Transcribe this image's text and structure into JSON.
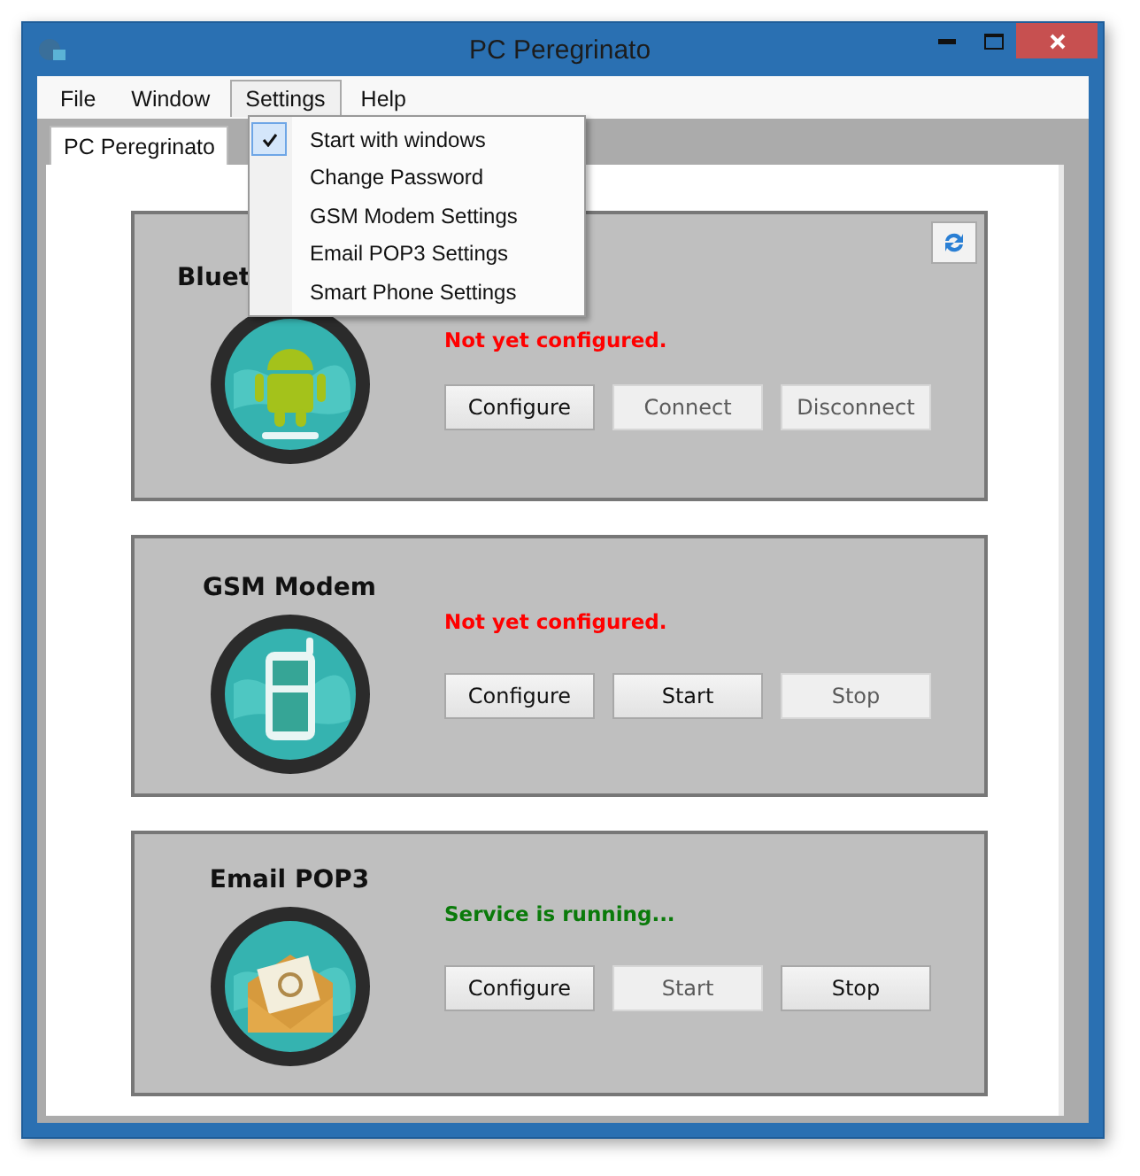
{
  "window": {
    "title": "PC Peregrinato"
  },
  "menu_bar": [
    {
      "label": "File",
      "selected": false
    },
    {
      "label": "Window",
      "selected": false
    },
    {
      "label": "Settings",
      "selected": true
    },
    {
      "label": "Help",
      "selected": false
    }
  ],
  "settings_menu": [
    {
      "label": "Start with windows",
      "checked": true
    },
    {
      "label": "Change Password",
      "checked": false
    },
    {
      "label": "GSM Modem Settings",
      "checked": false
    },
    {
      "label": "Email POP3 Settings",
      "checked": false
    },
    {
      "label": "Smart Phone Settings",
      "checked": false
    }
  ],
  "tabs": [
    {
      "label": "PC Peregrinato",
      "selected": true
    }
  ],
  "services": [
    {
      "title": "Bluet",
      "kind": "android",
      "refresh": true,
      "status": {
        "text": "Not yet configured.",
        "kind": "error"
      },
      "buttons": [
        {
          "label": "Configure",
          "disabled": false
        },
        {
          "label": "Connect",
          "disabled": true
        },
        {
          "label": "Disconnect",
          "disabled": true
        }
      ]
    },
    {
      "title": "GSM Modem",
      "kind": "phone",
      "refresh": false,
      "status": {
        "text": "Not yet configured.",
        "kind": "error"
      },
      "buttons": [
        {
          "label": "Configure",
          "disabled": false
        },
        {
          "label": "Start",
          "disabled": false
        },
        {
          "label": "Stop",
          "disabled": true
        }
      ]
    },
    {
      "title": "Email POP3",
      "kind": "email",
      "refresh": false,
      "status": {
        "text": "Service is running...",
        "kind": "ok"
      },
      "buttons": [
        {
          "label": "Configure",
          "disabled": false
        },
        {
          "label": "Start",
          "disabled": true
        },
        {
          "label": "Stop",
          "disabled": false
        }
      ]
    }
  ]
}
